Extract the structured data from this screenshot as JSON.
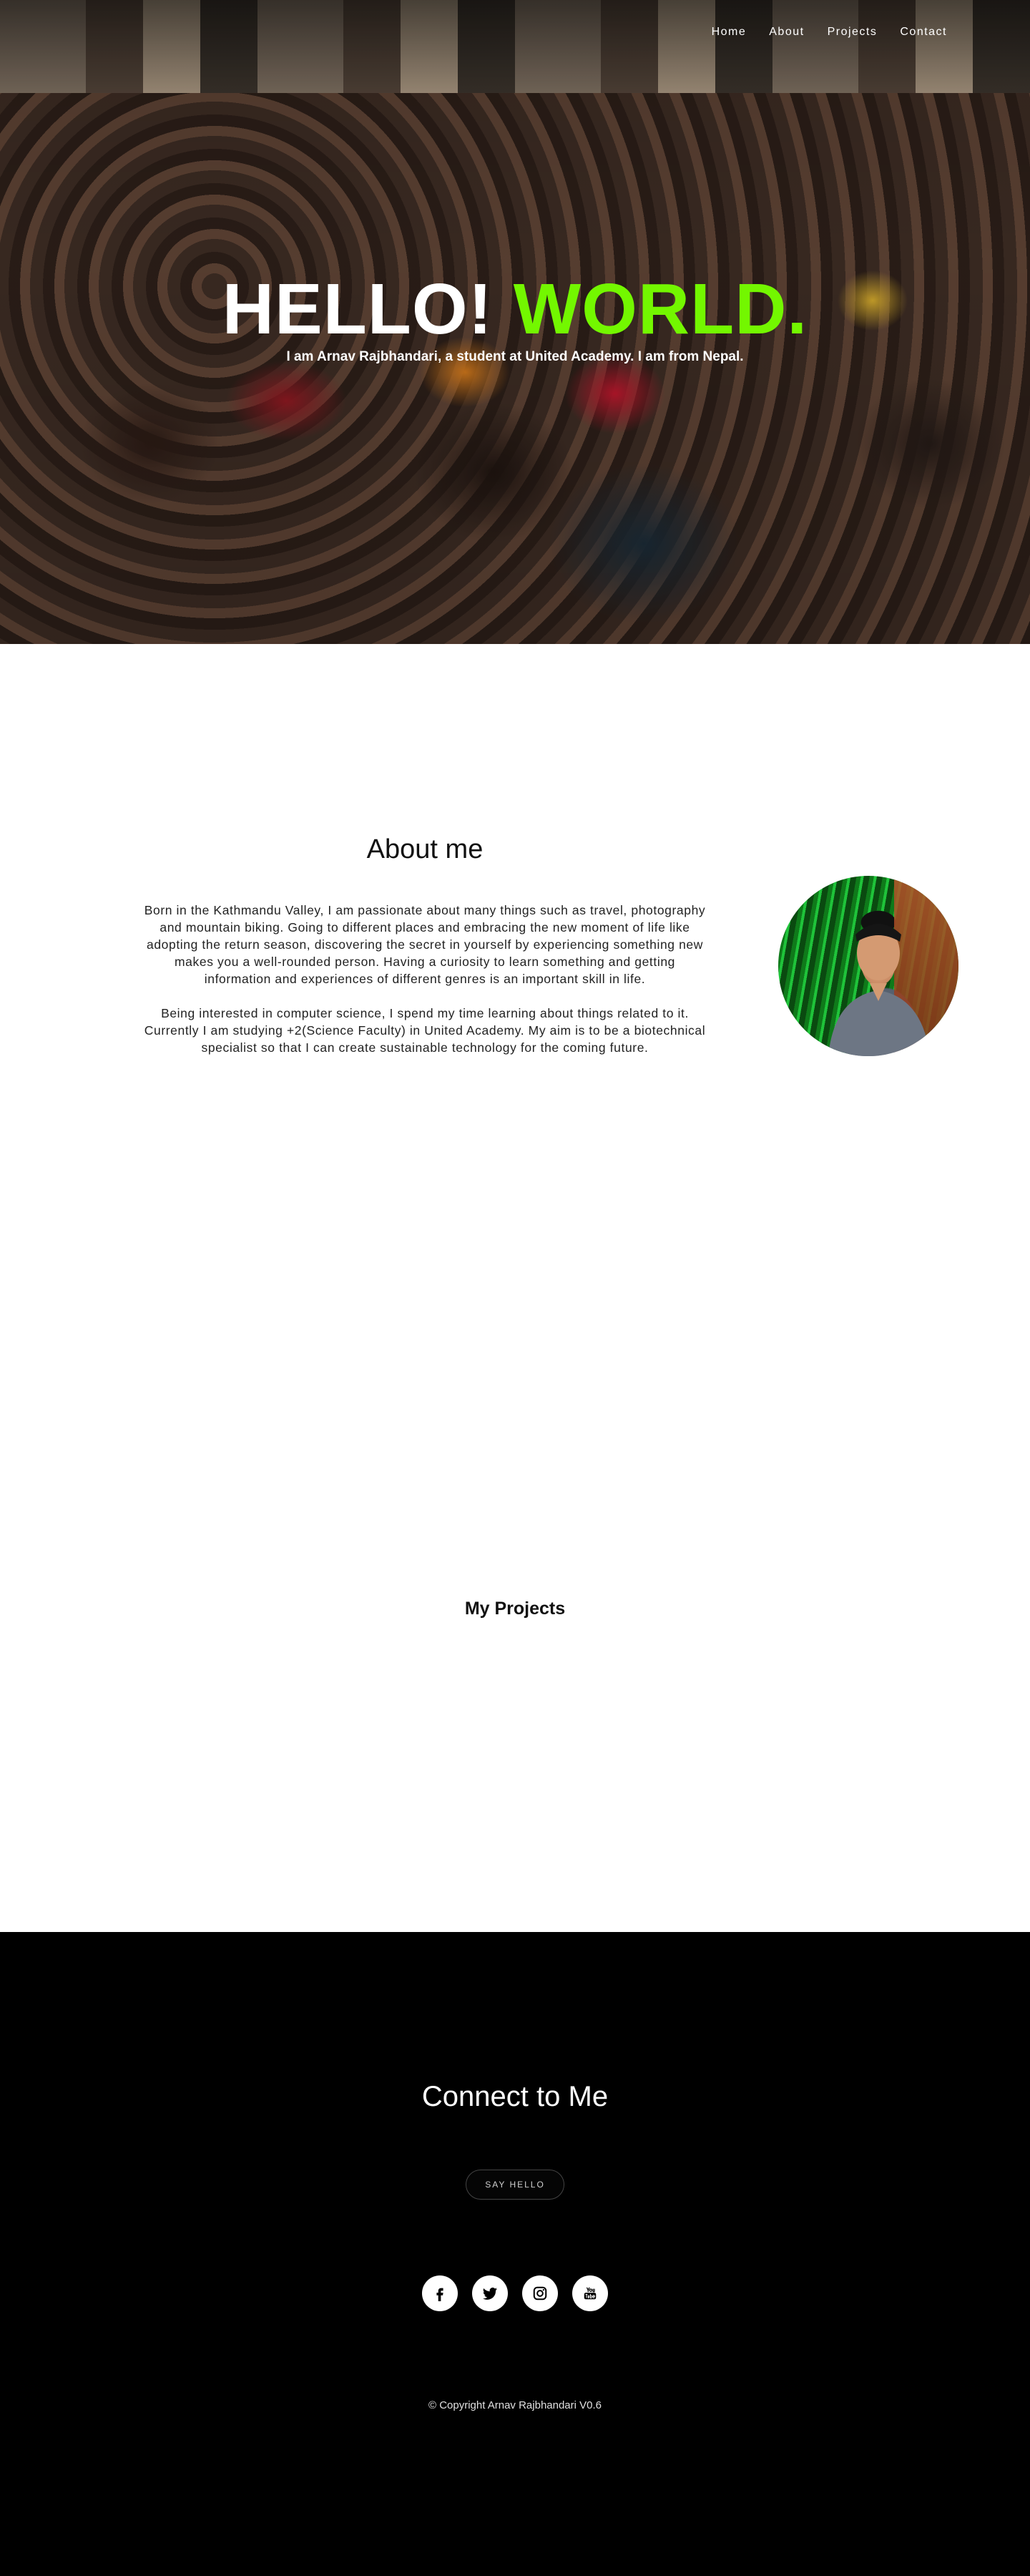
{
  "nav": {
    "items": [
      {
        "label": "Home"
      },
      {
        "label": "About"
      },
      {
        "label": "Projects"
      },
      {
        "label": "Contact"
      }
    ]
  },
  "hero": {
    "title_white": "HELLO!",
    "title_green": "WORLD.",
    "subtitle": "I am Arnav Rajbhandari, a student at United Academy. I am from Nepal.",
    "accent_color": "#73f700"
  },
  "about": {
    "title": "About me",
    "paragraphs": [
      "Born in the Kathmandu Valley, I am passionate about many things such as travel, photography and mountain biking. Going to different places and embracing the new moment of life like adopting the return season, discovering the secret in yourself by experiencing something new makes you a well-rounded person. Having a curiosity to learn something and getting information and experiences of different genres is an important skill in life.",
      "Being interested in computer science, I spend my time learning about things related to it. Currently I am studying +2(Science Faculty) in United Academy. My aim is to be a biotechnical specialist so that I can create sustainable technology for the coming future."
    ]
  },
  "projects": {
    "title": "My Projects"
  },
  "footer": {
    "title": "Connect to Me",
    "button_label": "SAY HELLO",
    "social": [
      {
        "icon": "facebook-icon"
      },
      {
        "icon": "twitter-icon"
      },
      {
        "icon": "instagram-icon"
      },
      {
        "icon": "youtube-icon"
      }
    ],
    "copyright": "© Copyright Arnav Rajbhandari V0.6"
  }
}
